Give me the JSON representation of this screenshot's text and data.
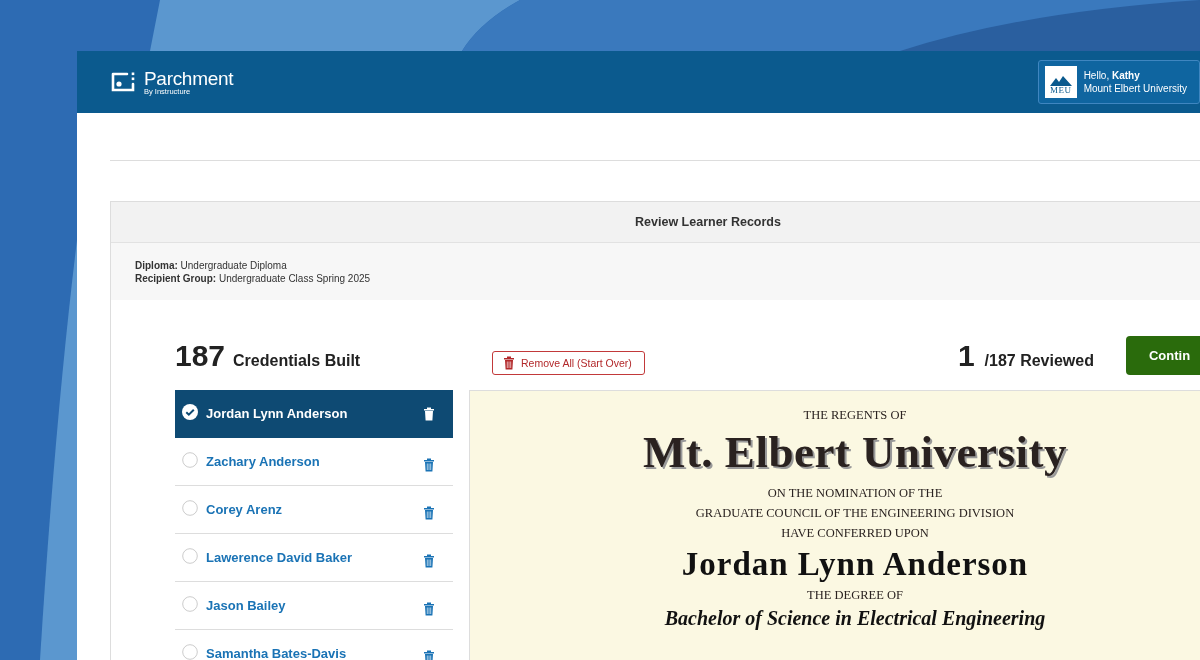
{
  "app": {
    "logo": "Parchment",
    "tagline": "By Instructure"
  },
  "user": {
    "badge": "MEU",
    "greeting": "Hello, **Kathy**",
    "institution": "Mount Elbert University"
  },
  "panel": {
    "title": "Review Learner Records",
    "details": [
      {
        "label": "Diploma:",
        "value": "Undergraduate Diploma"
      },
      {
        "label": "Recipient Group:",
        "value": "Undergraduate Class Spring 2025"
      }
    ]
  },
  "built": {
    "count": "187",
    "label": "Credentials Built"
  },
  "remove_all": "Remove All (Start Over)",
  "reviewed": {
    "count": "1",
    "label": "/187 Reviewed"
  },
  "continue_button": "Contin",
  "learners": [
    {
      "name": "Jordan Lynn Anderson",
      "selected": true
    },
    {
      "name": "Zachary Anderson",
      "selected": false
    },
    {
      "name": "Corey Arenz",
      "selected": false
    },
    {
      "name": "Lawerence David Baker",
      "selected": false
    },
    {
      "name": "Jason Bailey",
      "selected": false
    },
    {
      "name": "Samantha Bates-Davis",
      "selected": false
    }
  ],
  "diploma": {
    "lines": [
      {
        "kind": "caption",
        "text": "THE REGENTS OF"
      },
      {
        "kind": "title",
        "text": "Mt. Elbert University"
      },
      {
        "kind": "caption",
        "text": "ON THE NOMINATION OF THE"
      },
      {
        "kind": "caption",
        "text": "GRADUATE COUNCIL OF THE ENGINEERING DIVISION"
      },
      {
        "kind": "caption",
        "text": "HAVE CONFERRED UPON"
      },
      {
        "kind": "name",
        "text": "Jordan Lynn Anderson"
      },
      {
        "kind": "caption",
        "text": "THE DEGREE OF"
      },
      {
        "kind": "degree",
        "text": "Bachelor of Science in Electrical Engineering"
      }
    ]
  }
}
